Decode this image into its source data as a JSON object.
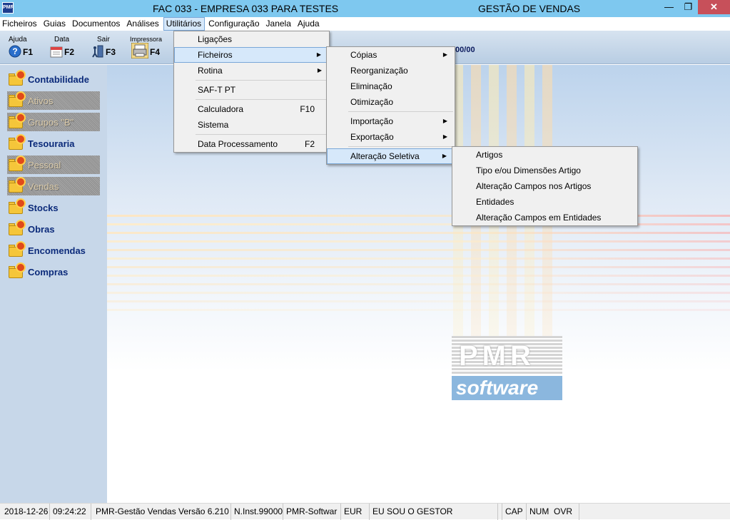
{
  "window": {
    "app_icon_text": "PMR",
    "title": "FAC 033 - EMPRESA 033 PARA TESTES",
    "module": "GESTÃO DE VENDAS",
    "min": "—",
    "max": "❐",
    "close": "✕"
  },
  "menubar": [
    {
      "label": "Ficheiros"
    },
    {
      "label": "Guias"
    },
    {
      "label": "Documentos"
    },
    {
      "label": "Análises"
    },
    {
      "label": "Utilitários"
    },
    {
      "label": "Configuração"
    },
    {
      "label": "Janela"
    },
    {
      "label": "Ajuda"
    }
  ],
  "toolbar": [
    {
      "label": "Ajuda",
      "key": "F1",
      "icon": "help-icon"
    },
    {
      "label": "Data",
      "key": "F2",
      "icon": "calendar-icon"
    },
    {
      "label": "Sair",
      "key": "F3",
      "icon": "exit-icon"
    },
    {
      "label": "Impressora",
      "key": "F4",
      "icon": "printer-icon"
    }
  ],
  "toolbar_date_fragment": "/00/00",
  "sidebar": [
    {
      "label": "Contabilidade",
      "enabled": true
    },
    {
      "label": "Ativos",
      "enabled": false
    },
    {
      "label": "Grupos \"B\"",
      "enabled": false
    },
    {
      "label": "Tesouraria",
      "enabled": true
    },
    {
      "label": "Pessoal",
      "enabled": false
    },
    {
      "label": "Vendas",
      "enabled": false
    },
    {
      "label": "Stocks",
      "enabled": true
    },
    {
      "label": "Obras",
      "enabled": true
    },
    {
      "label": "Encomendas",
      "enabled": true
    },
    {
      "label": "Compras",
      "enabled": true
    }
  ],
  "menu_utilitarios": {
    "items": [
      {
        "label": "Ligações",
        "shortcut": "",
        "submenu": false
      },
      {
        "label": "Ficheiros",
        "shortcut": "",
        "submenu": true
      },
      {
        "label": "Rotina",
        "shortcut": "",
        "submenu": true
      },
      {
        "label": "SAF-T PT",
        "shortcut": "",
        "submenu": false
      },
      {
        "label": "Calculadora",
        "shortcut": "F10",
        "submenu": false
      },
      {
        "label": "Sistema",
        "shortcut": "",
        "submenu": false
      },
      {
        "label": "Data Processamento",
        "shortcut": "F2",
        "submenu": false
      }
    ]
  },
  "menu_ficheiros": {
    "items": [
      {
        "label": "Cópias",
        "submenu": true
      },
      {
        "label": "Reorganização",
        "submenu": false
      },
      {
        "label": "Eliminação",
        "submenu": false
      },
      {
        "label": "Otimização",
        "submenu": false
      },
      {
        "label": "Importação",
        "submenu": true
      },
      {
        "label": "Exportação",
        "submenu": true
      },
      {
        "label": "Alteração Seletiva",
        "submenu": true
      }
    ]
  },
  "menu_alteracao": {
    "items": [
      {
        "label": "Artigos"
      },
      {
        "label": "Tipo e/ou Dimensões Artigo"
      },
      {
        "label": "Alteração Campos nos Artigos"
      },
      {
        "label": "Entidades"
      },
      {
        "label": "Alteração Campos em Entidades"
      }
    ]
  },
  "logo": {
    "top": "PMR",
    "bottom": "software"
  },
  "statusbar": [
    "2018-12-26",
    "09:24:22",
    "PMR-Gestão Vendas  Versão  6.210",
    "N.Inst.99000",
    "PMR-Softwar",
    "EUR",
    "EU SOU O GESTOR",
    "",
    "CAP",
    "NUM",
    "OVR"
  ],
  "colors": {
    "titlebar": "#7ec8ef",
    "close_button": "#c7505a",
    "sidebar": "#c7d7e9",
    "sidebar_text": "#0b2a7a",
    "menu_highlight": "#d6e8fa"
  }
}
